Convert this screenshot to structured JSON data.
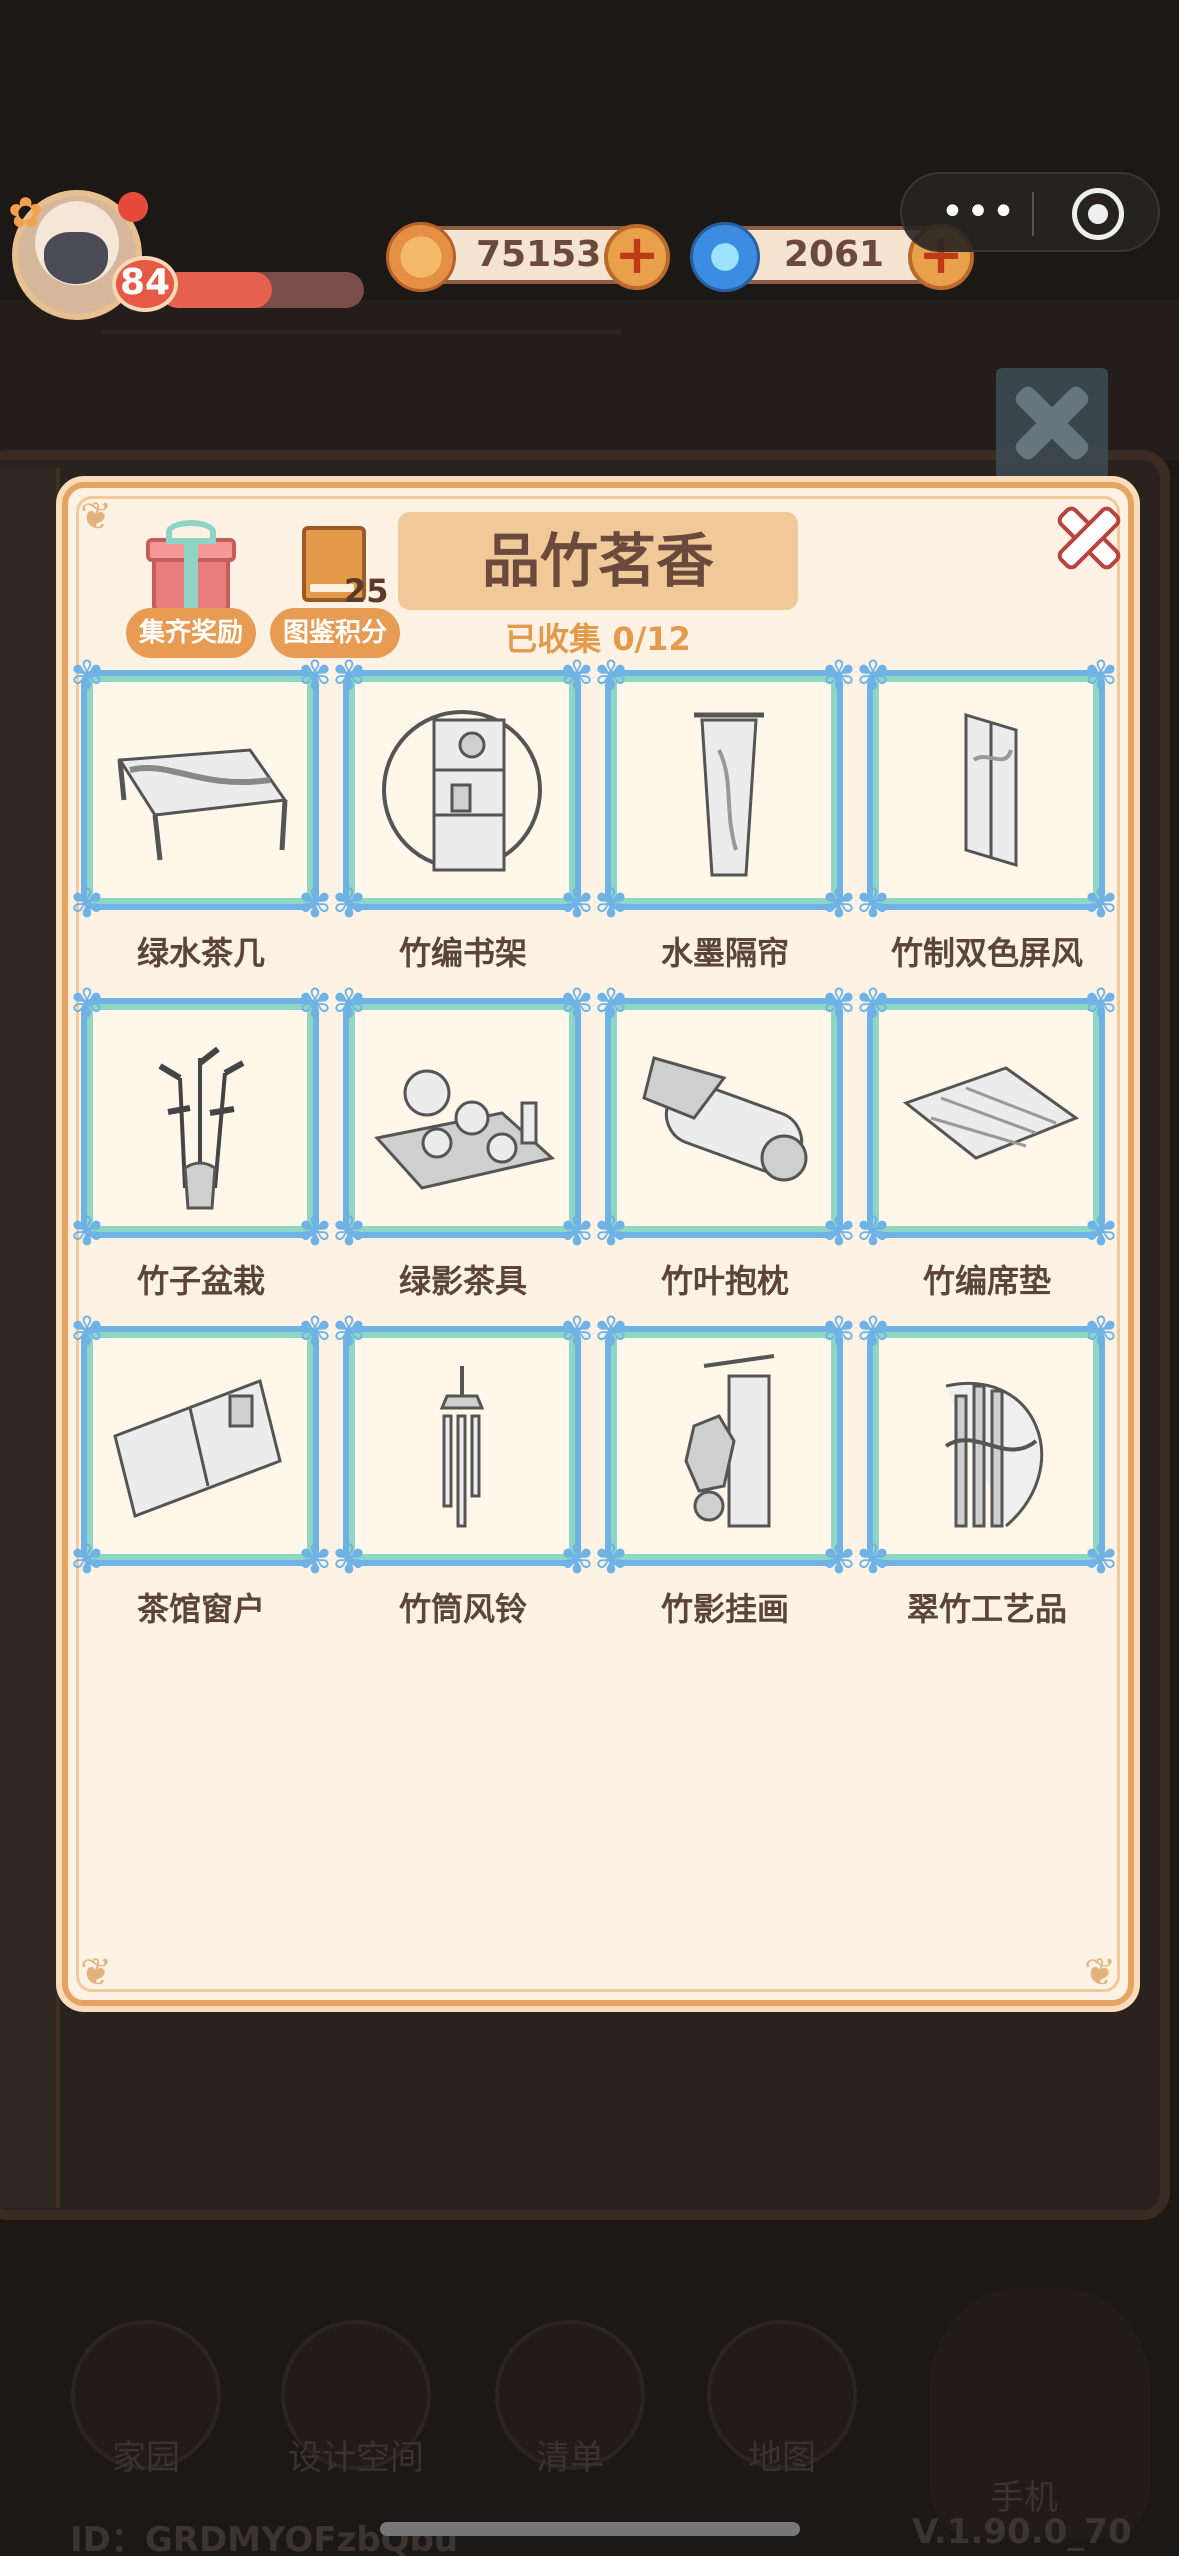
{
  "hud": {
    "level": "84",
    "xp_fraction": 0.55,
    "coins": "75153",
    "gems": "2061",
    "capsule_menu": "•••"
  },
  "album": {
    "title": "品竹茗香",
    "collected_text": "已收集 0/12",
    "reward_label": "集齐奖励",
    "points_label": "图鉴积分",
    "points_value": "25",
    "items": [
      {
        "name": "绿水茶几",
        "icon": "tea-table-icon"
      },
      {
        "name": "竹编书架",
        "icon": "bamboo-bookshelf-icon"
      },
      {
        "name": "水墨隔帘",
        "icon": "ink-curtain-icon"
      },
      {
        "name": "竹制双色屏风",
        "icon": "folding-screen-icon"
      },
      {
        "name": "竹子盆栽",
        "icon": "bamboo-bonsai-icon"
      },
      {
        "name": "绿影茶具",
        "icon": "tea-set-icon"
      },
      {
        "name": "竹叶抱枕",
        "icon": "bolster-pillow-icon"
      },
      {
        "name": "竹编席垫",
        "icon": "woven-mat-icon"
      },
      {
        "name": "茶馆窗户",
        "icon": "teahouse-window-icon"
      },
      {
        "name": "竹筒风铃",
        "icon": "wind-chime-icon"
      },
      {
        "name": "竹影挂画",
        "icon": "hanging-scroll-icon"
      },
      {
        "name": "翠竹工艺品",
        "icon": "bamboo-craft-icon"
      }
    ]
  },
  "nav": {
    "items": [
      {
        "label": "家园"
      },
      {
        "label": "设计空间"
      },
      {
        "label": "清单"
      },
      {
        "label": "地图"
      },
      {
        "label": "手机"
      }
    ]
  },
  "footer": {
    "id_text": "ID：GRDMYOFzbQbu",
    "version": "V.1.90.0_70"
  }
}
